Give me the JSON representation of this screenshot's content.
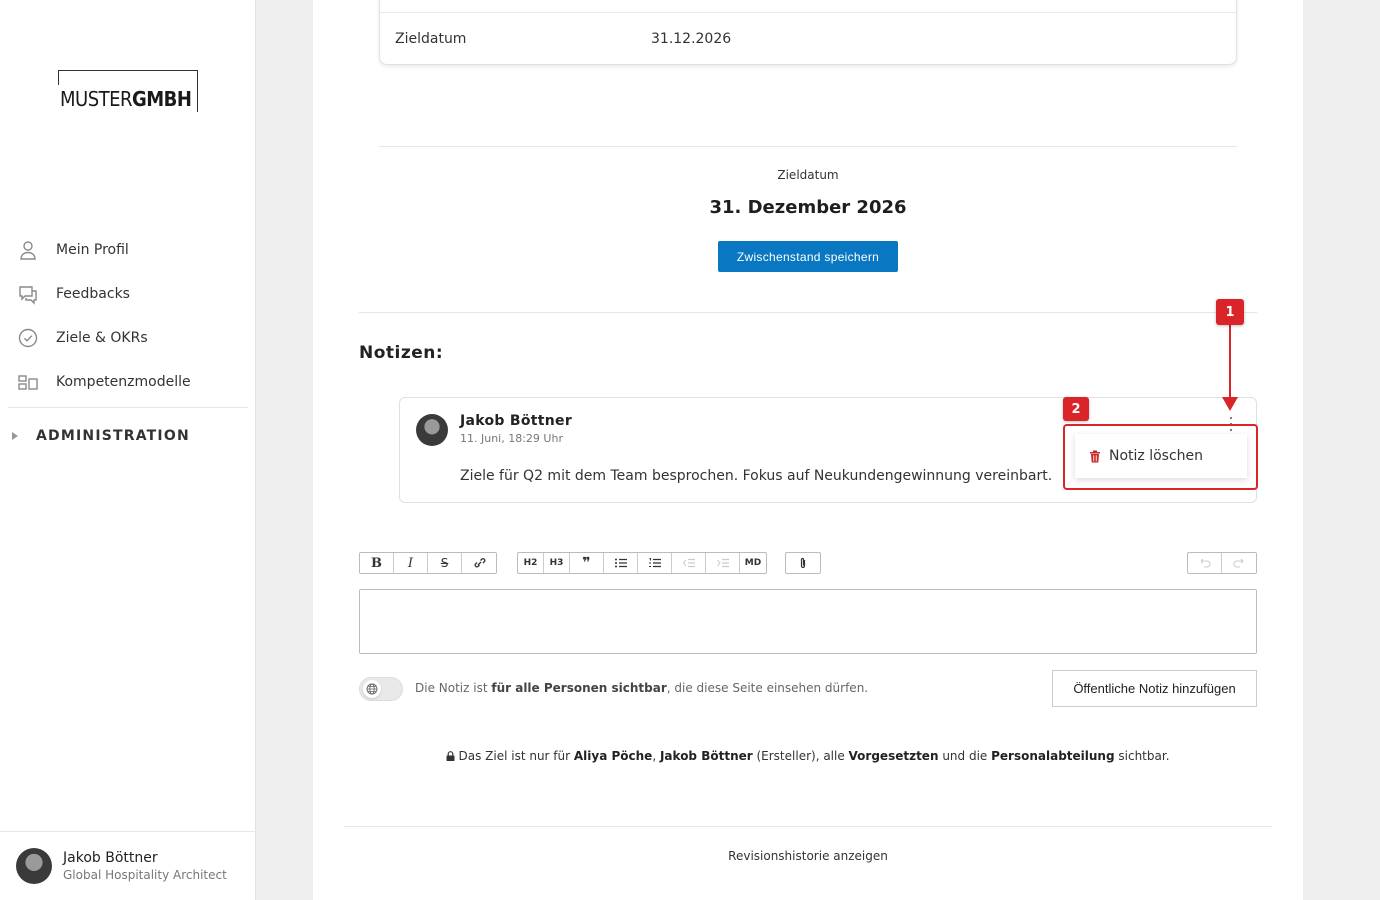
{
  "sidebar": {
    "logo": {
      "light": "MUSTER",
      "bold": "GMBH"
    },
    "items": [
      {
        "label": "Mein Profil",
        "icon": "user-icon"
      },
      {
        "label": "Feedbacks",
        "icon": "chat-bubbles-icon"
      },
      {
        "label": "Ziele & OKRs",
        "icon": "check-circle-icon"
      },
      {
        "label": "Kompetenzmodelle",
        "icon": "layout-blocks-icon"
      }
    ],
    "admin_label": "ADMINISTRATION",
    "user": {
      "name": "Jakob Böttner",
      "role": "Global Hospitality Architect"
    }
  },
  "goal": {
    "kv": {
      "key": "Zieldatum",
      "value": "31.12.2026"
    },
    "target_caption": "Zieldatum",
    "target_date": "31. Dezember 2026",
    "save_label": "Zwischenstand speichern"
  },
  "notes": {
    "title": "Notizen:",
    "items": [
      {
        "author": "Jakob Böttner",
        "time": "11. Juni, 18:29 Uhr",
        "text": "Ziele für Q2 mit dem Team besprochen. Fokus auf Neukundengewinnung vereinbart."
      }
    ],
    "menu": {
      "delete_label": "Notiz löschen"
    },
    "annotations": {
      "badge1": "1",
      "badge2": "2",
      "color": "#d9252a"
    }
  },
  "editor": {
    "toolbar": {
      "format": [
        "B",
        "I",
        "S",
        "link"
      ],
      "blocks": [
        "H2",
        "H3",
        "quote",
        "ul",
        "ol",
        "outdent",
        "indent",
        "MD"
      ],
      "attach": "attach",
      "history": [
        "undo",
        "redo"
      ]
    },
    "h2": "H2",
    "h3": "H3",
    "md": "MD",
    "visibility": {
      "prefix": "Die Notiz ist ",
      "bold": "für alle Personen sichtbar",
      "suffix": ", die diese Seite einsehen dürfen."
    },
    "public_button": "Öffentliche Notiz hinzufügen"
  },
  "privacy": {
    "t1": "Das Ziel ist nur für ",
    "b1": "Aliya Pöche",
    "t2": ", ",
    "b2": "Jakob Böttner",
    "t3": " (Ersteller), alle ",
    "b3": "Vorgesetzten",
    "t4": " und die ",
    "b4": "Personalabteilung",
    "t5": " sichtbar."
  },
  "revision_link": "Revisionshistorie anzeigen",
  "colors": {
    "primary": "#0a77c2",
    "annotation": "#d9252a",
    "trash": "#c62828"
  }
}
